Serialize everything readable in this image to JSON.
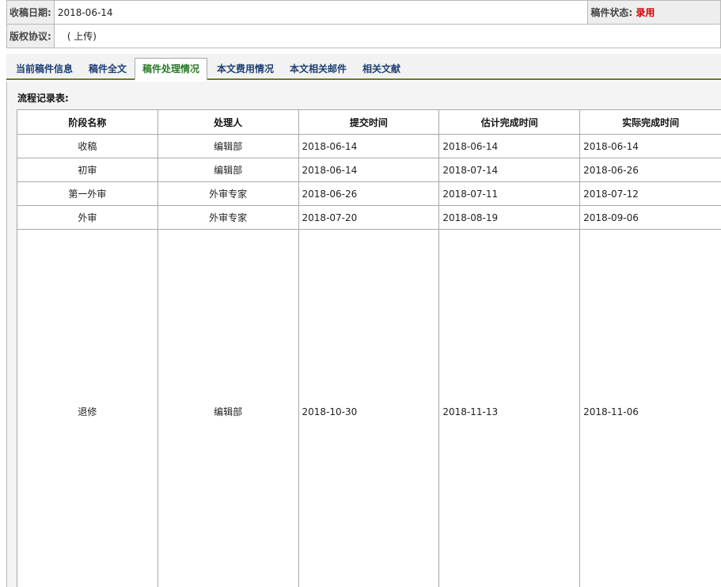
{
  "info": {
    "received_label": "收稿日期:",
    "received_value": "2018-06-14",
    "status_label": "稿件状态:",
    "status_value": "录用",
    "copyright_label": "版权协议:",
    "copyright_value": "( 上传)"
  },
  "tabs": [
    {
      "label": "当前稿件信息"
    },
    {
      "label": "稿件全文"
    },
    {
      "label": "稿件处理情况"
    },
    {
      "label": "本文费用情况"
    },
    {
      "label": "本文相关邮件"
    },
    {
      "label": "相关文献"
    }
  ],
  "active_tab": "稿件处理情况",
  "process": {
    "title": "流程记录表:",
    "columns": [
      "阶段名称",
      "处理人",
      "提交时间",
      "估计完成时间",
      "实际完成时间"
    ],
    "rows": [
      [
        "收稿",
        "编辑部",
        "2018-06-14",
        "2018-06-14",
        "2018-06-14"
      ],
      [
        "初审",
        "编辑部",
        "2018-06-14",
        "2018-07-14",
        "2018-06-26"
      ],
      [
        "第一外审",
        "外审专家",
        "2018-06-26",
        "2018-07-11",
        "2018-07-12"
      ],
      [
        "外审",
        "外审专家",
        "2018-07-20",
        "2018-08-19",
        "2018-09-06"
      ],
      [
        "退修",
        "编辑部",
        "2018-10-30",
        "2018-11-13",
        "2018-11-06"
      ]
    ]
  },
  "colors": {
    "status": "#d40000",
    "tab_text": "#1e3f73",
    "active_tab_text": "#2a7a2a",
    "tab_underline": "#6f7a2a"
  }
}
